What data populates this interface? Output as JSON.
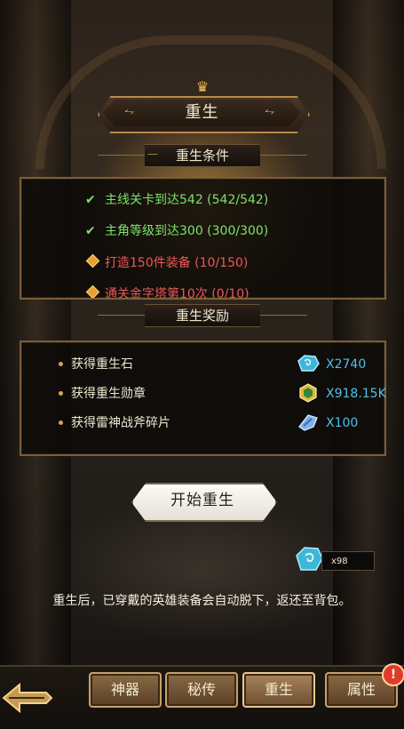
{
  "title": "重生",
  "conditions": {
    "header": "重生条件",
    "items": [
      {
        "text": "主线关卡到达542 (542/542)",
        "status": "complete"
      },
      {
        "text": "主角等级到达300 (300/300)",
        "status": "complete"
      },
      {
        "text": "打造150件装备 (10/150)",
        "status": "incomplete"
      },
      {
        "text": "通关金字塔第10次 (0/10)",
        "status": "incomplete"
      }
    ]
  },
  "rewards": {
    "header": "重生奖励",
    "items": [
      {
        "label": "获得重生石",
        "value": "X2740",
        "icon": "rebirth-stone-icon"
      },
      {
        "label": "获得重生勋章",
        "value": "X918.15K",
        "icon": "rebirth-medal-icon"
      },
      {
        "label": "获得雷神战斧碎片",
        "value": "X100",
        "icon": "axe-fragment-icon"
      }
    ]
  },
  "start_button": "开始重生",
  "stone_count": "x98",
  "note": "重生后，已穿戴的英雄装备会自动脱下，返还至背包。",
  "nav": {
    "tabs": [
      "神器",
      "秘传",
      "重生",
      "属性"
    ],
    "active": "重生",
    "badge": "!"
  },
  "colors": {
    "complete": "#7be36a",
    "incomplete": "#ee5757",
    "reward_value": "#4fc0e8",
    "accent": "#c7a06a"
  }
}
